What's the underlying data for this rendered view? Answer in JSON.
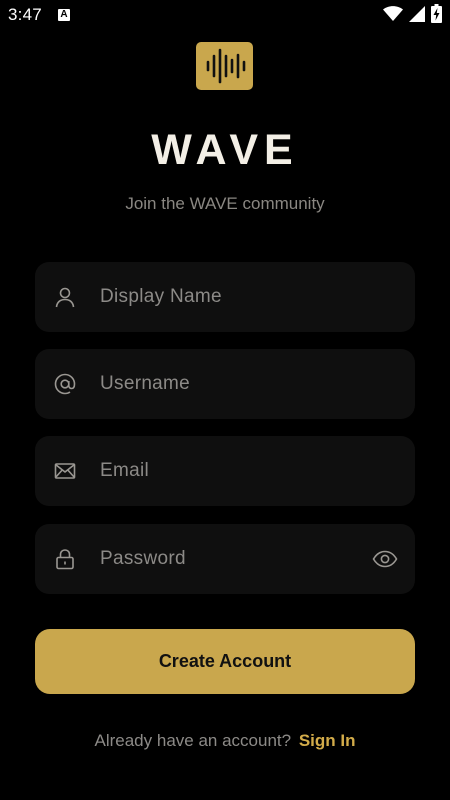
{
  "status_bar": {
    "time": "3:47",
    "notification_badge": "A",
    "icons": [
      "wifi-icon",
      "signal-icon",
      "battery-charging-icon"
    ]
  },
  "brand": {
    "logo_icon": "sound-wave-icon",
    "title": "WAVE",
    "subtitle": "Join the WAVE community"
  },
  "form": {
    "display_name": {
      "placeholder": "Display Name",
      "value": "",
      "icon": "person-icon"
    },
    "username": {
      "placeholder": "Username",
      "value": "",
      "icon": "at-sign-icon"
    },
    "email": {
      "placeholder": "Email",
      "value": "",
      "icon": "envelope-icon"
    },
    "password": {
      "placeholder": "Password",
      "value": "",
      "icon": "lock-icon",
      "toggle_icon": "eye-icon"
    },
    "submit_label": "Create Account"
  },
  "footer": {
    "prompt": "Already have an account?",
    "link": "Sign In"
  },
  "colors": {
    "background": "#000000",
    "accent": "#c9a74d",
    "field_background": "#0f0f0f",
    "muted_text": "#8c8a87",
    "title_text": "#f3efe6"
  }
}
